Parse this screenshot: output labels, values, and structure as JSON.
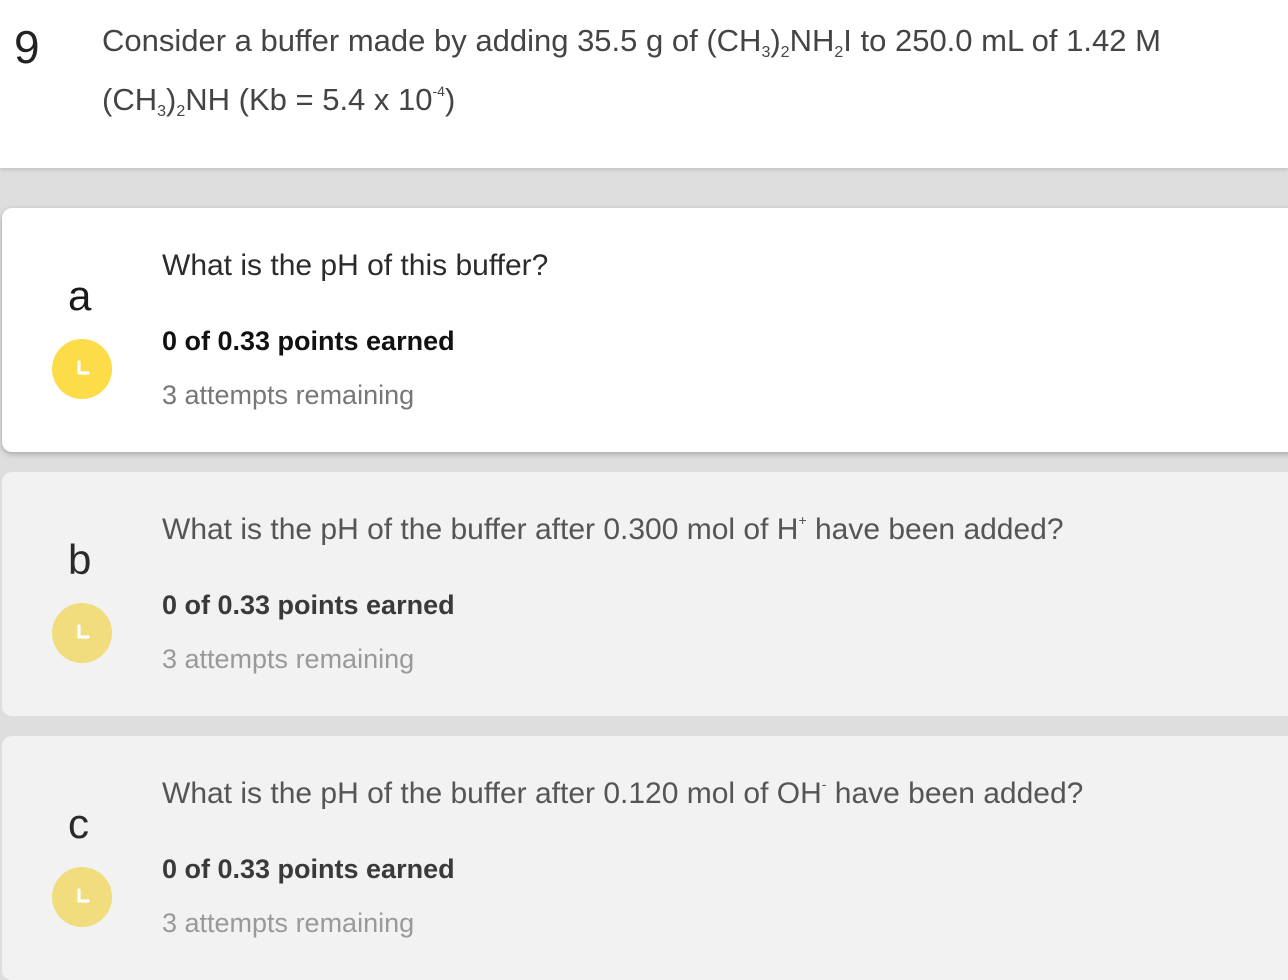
{
  "question": {
    "number": "9",
    "text": {
      "p1": "Consider a buffer made by adding 35.5 g of (CH",
      "s1": "3",
      "p2": ")",
      "s2": "2",
      "p3": "NH",
      "s3": "2",
      "p4": "I to 250.0 mL of 1.42 M (CH",
      "s4": "3",
      "p5": ")",
      "s5": "2",
      "p6": "NH (Kb = 5.4 x 10",
      "sup1": "-4",
      "p7": ")"
    }
  },
  "parts": [
    {
      "letter": "a",
      "prompt_main": "What is the pH of this buffer?",
      "prompt_sup": "",
      "prompt_end": "",
      "points": "0 of 0.33 points earned",
      "attempts": "3 attempts remaining",
      "status_icon": "clock-icon",
      "active": true
    },
    {
      "letter": "b",
      "prompt_main": "What is the pH of the buffer after 0.300 mol of H",
      "prompt_sup": "+",
      "prompt_end": " have been added?",
      "points": "0 of 0.33 points earned",
      "attempts": "3 attempts remaining",
      "status_icon": "clock-icon",
      "active": false
    },
    {
      "letter": "c",
      "prompt_main": "What is the pH of the buffer after 0.120 mol of OH",
      "prompt_sup": "-",
      "prompt_end": " have been added?",
      "points": "0 of 0.33 points earned",
      "attempts": "3 attempts remaining",
      "status_icon": "clock-icon",
      "active": false
    }
  ],
  "colors": {
    "clock_active": "#fcdc48",
    "clock_inactive": "#f1dc7e",
    "background": "#dedede"
  }
}
